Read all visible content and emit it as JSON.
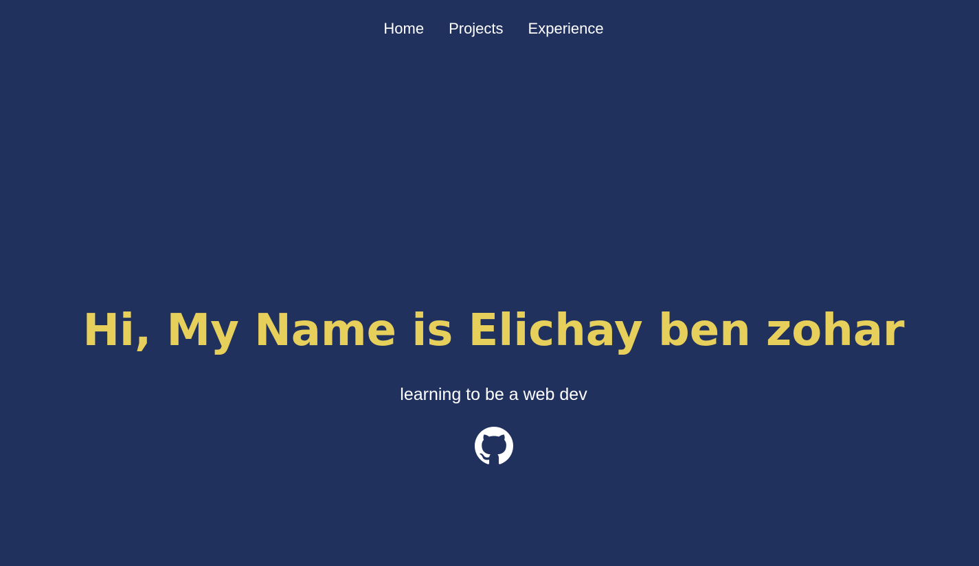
{
  "nav": {
    "items": [
      {
        "label": "Home"
      },
      {
        "label": "Projects"
      },
      {
        "label": "Experience"
      }
    ]
  },
  "hero": {
    "title": "Hi, My Name is Elichay ben zohar",
    "subtitle": "learning to be a web dev"
  },
  "icons": {
    "github": "github-icon"
  },
  "colors": {
    "background": "#21315e",
    "accent": "#e6cf5a",
    "text": "#ffffff"
  }
}
